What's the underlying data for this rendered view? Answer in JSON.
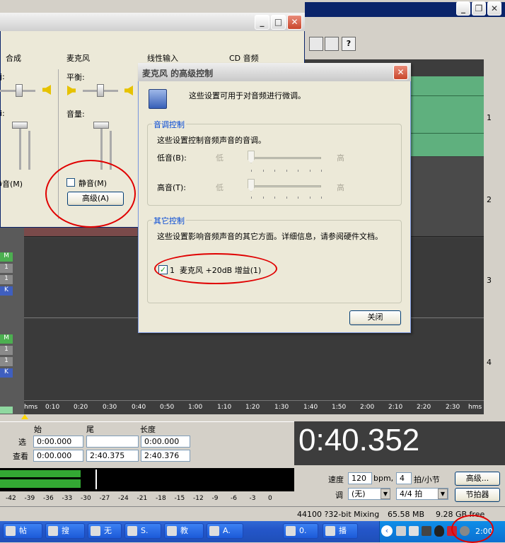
{
  "mixer": {
    "columns": [
      "合成",
      "麦克风",
      "线性输入",
      "CD 音频"
    ],
    "balance_label": "平衡:",
    "volume_label": "音量:",
    "mute_label": "静音(M)",
    "left_mute_fragment": "静音(M)",
    "left_fragment_colon1": "j:",
    "left_fragment_colon2": "i:",
    "advanced_button": "高级(A)"
  },
  "dialog": {
    "title": "麦克风 的高级控制",
    "intro": "这些设置可用于对音频进行微调。",
    "tone_group": "音调控制",
    "tone_desc": "这些设置控制音频声音的音调。",
    "bass_label": "低音(B):",
    "treble_label": "高音(T):",
    "low": "低",
    "high": "高",
    "other_group": "其它控制",
    "other_desc": "这些设置影响音频声音的其它方面。详细信息，请参阅硬件文档。",
    "boost_checkbox": "1  麦克风 +20dB 增益(1)",
    "close_button": "关闭"
  },
  "editor": {
    "track_numbers": [
      "1",
      "2",
      "3",
      "4"
    ],
    "timeline_labels": [
      "hms",
      "0:10",
      "0:20",
      "0:30",
      "0:40",
      "0:50",
      "1:00",
      "1:10",
      "1:20",
      "1:30",
      "1:40",
      "1:50",
      "2:00",
      "2:10",
      "2:20",
      "2:30",
      "hms"
    ],
    "track_buttons": [
      "M",
      "1",
      "1",
      "K"
    ],
    "selection": {
      "header_start": "始",
      "header_end": "尾",
      "header_length": "长度",
      "row1_label": "选",
      "row2_label": "查看",
      "sel_start": "0:00.000",
      "sel_end": "",
      "sel_length": "0:00.000",
      "view_start": "0:00.000",
      "view_end": "2:40.375",
      "view_length": "2:40.376"
    },
    "time_display": "0:40.352",
    "meter_labels": [
      "-42",
      "-39",
      "-36",
      "-33",
      "-30",
      "-27",
      "-24",
      "-21",
      "-18",
      "-15",
      "-12",
      "-9",
      "-6",
      "-3",
      "0"
    ],
    "tempo_label": "速度",
    "tempo_value": "120",
    "bpm_unit": "bpm,",
    "beats_value": "4",
    "beats_unit": "拍/小节",
    "advanced_btn": "高级...",
    "key_label": "调",
    "key_value": "(无)",
    "time_sig": "4/4 拍",
    "metronome_btn": "节拍器",
    "status_format": "44100 ?32-bit Mixing",
    "status_mem": "65.58 MB",
    "status_disk": "9.28 GB free"
  },
  "taskbar": {
    "items": [
      "帖",
      "搜",
      "无",
      "S.",
      "教",
      "A.",
      "0.",
      "播"
    ],
    "clock": "2:00"
  },
  "colors": {
    "track_bg": "#3d3d3d",
    "waveform": "#5fb07e",
    "time_text": "#ffffff",
    "xp_blue": "#0a246a",
    "annotation": "#e00000"
  }
}
